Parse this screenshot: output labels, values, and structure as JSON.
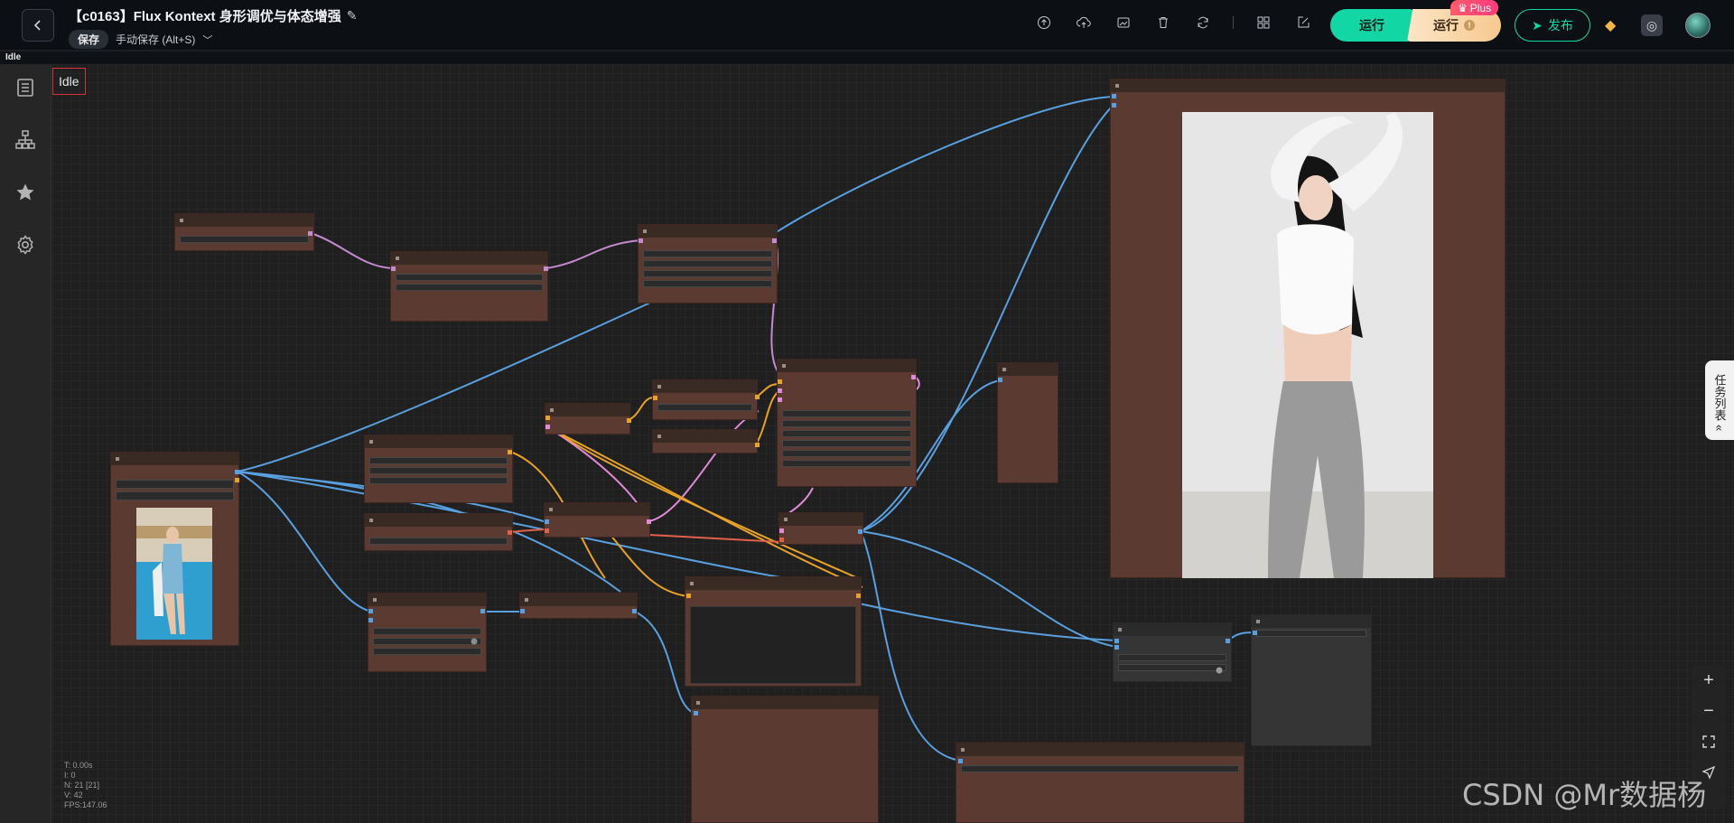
{
  "header": {
    "title": "【c0163】Flux Kontext 身形调优与体态增强",
    "save_label": "保存",
    "autosave_label": "手动保存 (Alt+S)",
    "run_label": "运行",
    "run_plus_label": "运行",
    "plus_badge": "Plus",
    "publish_label": "发布",
    "icons": [
      "upload-icon",
      "cloud-upload-icon",
      "image-export-icon",
      "trash-icon",
      "refresh-icon",
      "grid-icon",
      "edit-check-icon"
    ]
  },
  "status_strip": {
    "text": "Idle"
  },
  "canvas": {
    "status_label": "Idle",
    "stats": {
      "t": "T: 0.00s",
      "i": "I: 0",
      "n": "N: 21 [21]",
      "v": "V: 42",
      "fps": "FPS:147.06"
    }
  },
  "sidebar": {
    "items": [
      {
        "name": "workflow-list-icon"
      },
      {
        "name": "model-tree-icon"
      },
      {
        "name": "favorites-star-icon"
      },
      {
        "name": "settings-gear-icon"
      }
    ]
  },
  "task_tab": {
    "label": "任务列表",
    "collapse_icon": "«"
  },
  "zoom": {
    "plus": "+",
    "minus": "−"
  },
  "watermark": "CSDN @Mr数据杨",
  "colors": {
    "accent": "#12d6a4",
    "node_bg": "#5b3a32",
    "wire_blue": "#5aa0e0",
    "wire_pink": "#e08ad8",
    "wire_orange": "#e8a22a",
    "wire_red": "#e0604a"
  }
}
